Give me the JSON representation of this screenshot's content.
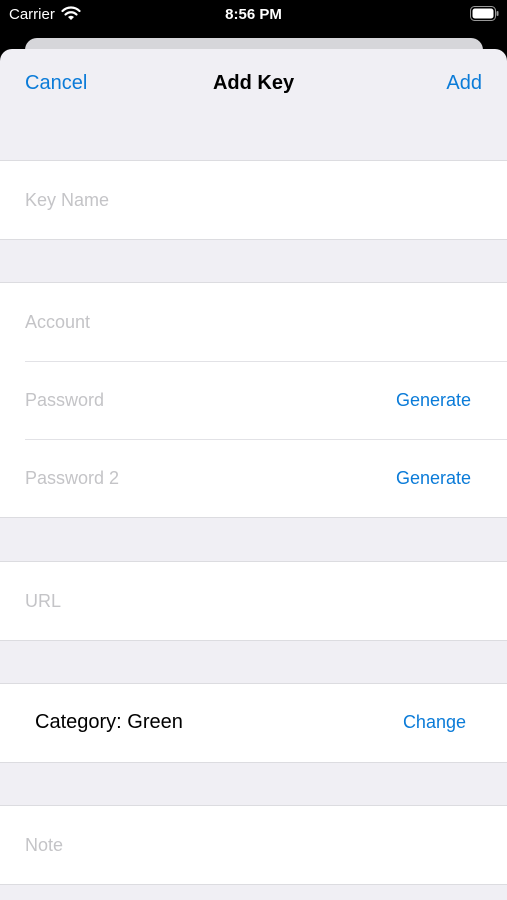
{
  "status_bar": {
    "carrier": "Carrier",
    "time": "8:56 PM"
  },
  "nav": {
    "cancel": "Cancel",
    "title": "Add Key",
    "add": "Add"
  },
  "fields": {
    "key_name": {
      "placeholder": "Key Name"
    },
    "account": {
      "placeholder": "Account"
    },
    "password": {
      "placeholder": "Password",
      "action": "Generate"
    },
    "password2": {
      "placeholder": "Password 2",
      "action": "Generate"
    },
    "url": {
      "placeholder": "URL"
    },
    "category": {
      "label": "Category: Green",
      "action": "Change"
    },
    "note": {
      "placeholder": "Note"
    }
  },
  "colors": {
    "accent": "#0a7bd8",
    "background": "#f0eff4",
    "placeholder": "#c4c4c7"
  }
}
